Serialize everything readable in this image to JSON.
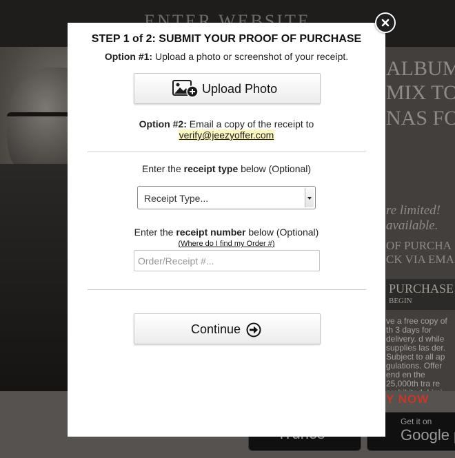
{
  "background": {
    "header_text": "ENTER WEBSITE",
    "right_lines": [
      "ALBUM",
      "MIX TO",
      "NAS FO"
    ],
    "limited_lines": [
      "re limited!",
      "available."
    ],
    "purch_lines": [
      "OF PURCHA",
      "CK VIA EMA"
    ],
    "purchase_title": "PURCHASE",
    "purchase_sub": "BEGIN",
    "fine_print": "ve a free copy of th 3 days for delivery. d while supplies las der. Subject to all ap gulations. Offer end en the 25,000th tra re prohibited. Limi address.",
    "buy_now": "Y NOW",
    "google_play_small": "Get it on",
    "google_play_big": "Google p",
    "itunes_text": "iTunes"
  },
  "modal": {
    "title": "STEP 1 of 2: SUBMIT YOUR PROOF OF PURCHASE",
    "option1_label": "Option #1:",
    "option1_text": " Upload a photo or screenshot of your receipt.",
    "upload_button_label": "Upload Photo",
    "option2_label": "Option #2:",
    "option2_text": " Email a copy of the receipt to",
    "email": "verify@jeezyoffer.com",
    "receipt_type_prefix": "Enter the ",
    "receipt_type_bold": "receipt type",
    "receipt_type_suffix": " below (Optional)",
    "receipt_type_selected": "Receipt Type...",
    "receipt_number_prefix": "Enter the ",
    "receipt_number_bold": "receipt number",
    "receipt_number_suffix": " below (Optional)",
    "help_link": "(Where do I find my Order #)",
    "receipt_number_placeholder": "Order/Receipt #...",
    "continue_label": "Continue"
  },
  "icons": {
    "close": "close-icon",
    "upload": "add-photo-icon",
    "continue": "arrow-right-circle-icon"
  }
}
